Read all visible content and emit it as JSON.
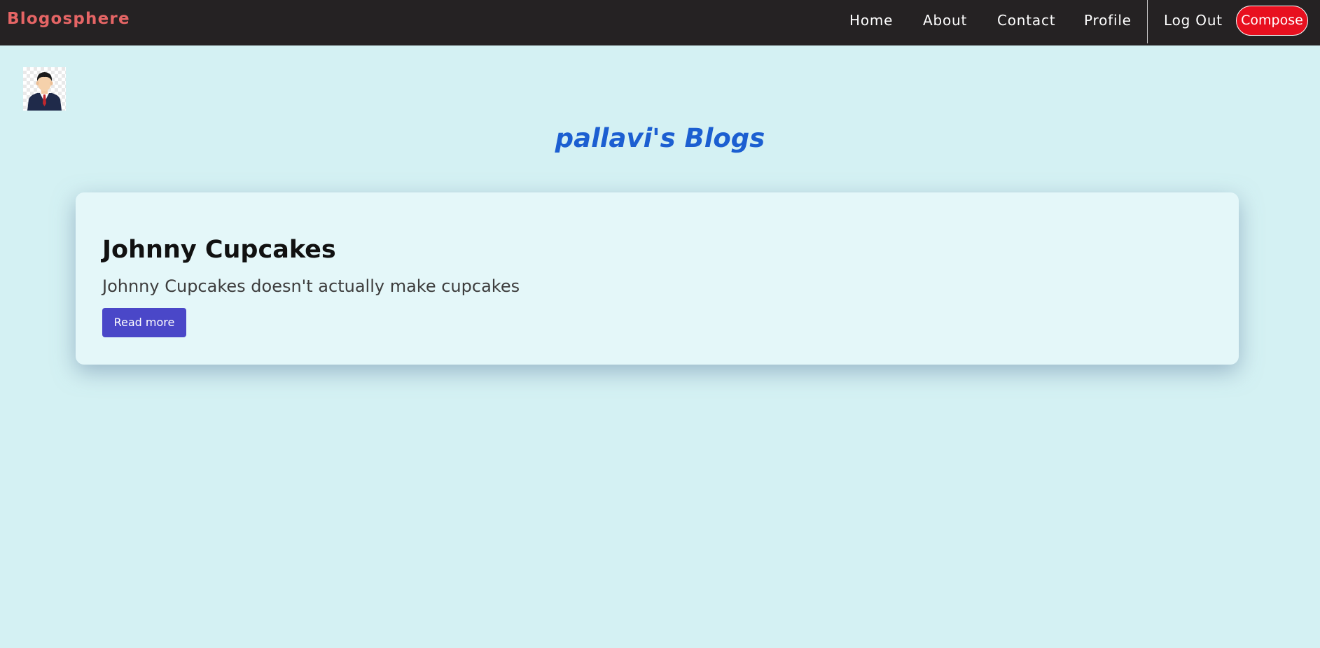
{
  "navbar": {
    "brand": "Blogosphere",
    "links": [
      {
        "label": "Home"
      },
      {
        "label": "About"
      },
      {
        "label": "Contact"
      },
      {
        "label": "Profile"
      },
      {
        "label": "Log Out"
      }
    ],
    "compose_label": "Compose"
  },
  "profile": {
    "avatar_icon": "user-avatar-icon"
  },
  "main": {
    "title": "pallavi's Blogs",
    "posts": [
      {
        "title": "Johnny Cupcakes",
        "excerpt": "Johnny Cupcakes doesn't actually make cupcakes",
        "button_label": "Read more"
      }
    ]
  },
  "colors": {
    "navbar_bg": "#252223",
    "brand": "#e56565",
    "compose_bg": "#e8101f",
    "page_bg": "#d4f1f3",
    "card_bg": "#e4f7f9",
    "title": "#1c5fd1",
    "button_bg": "#4a47c8"
  }
}
